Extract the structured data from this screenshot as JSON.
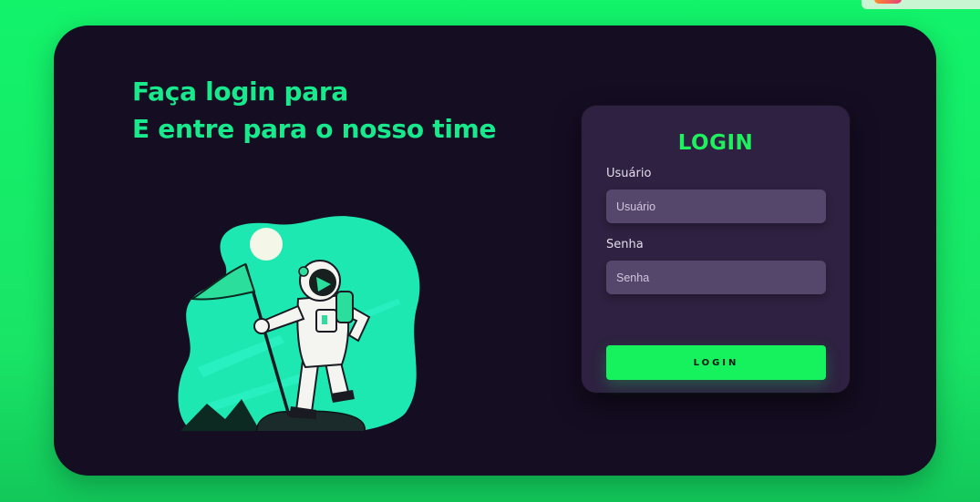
{
  "hero": {
    "line1": "Faça login para",
    "line2": "E entre para o nosso time"
  },
  "illustration": {
    "icon": "astronaut-with-flag-illustration"
  },
  "login_form": {
    "title": "LOGIN",
    "username_label": "Usuário",
    "username_placeholder": "Usuário",
    "password_label": "Senha",
    "password_placeholder": "Senha",
    "submit_label": "LOGIN"
  },
  "colors": {
    "page_background": "#12f36a",
    "card_background": "#150d22",
    "accent_text": "#17e98c",
    "form_background": "#2e2141",
    "input_background": "#55476c",
    "button_background": "#16f25d"
  }
}
